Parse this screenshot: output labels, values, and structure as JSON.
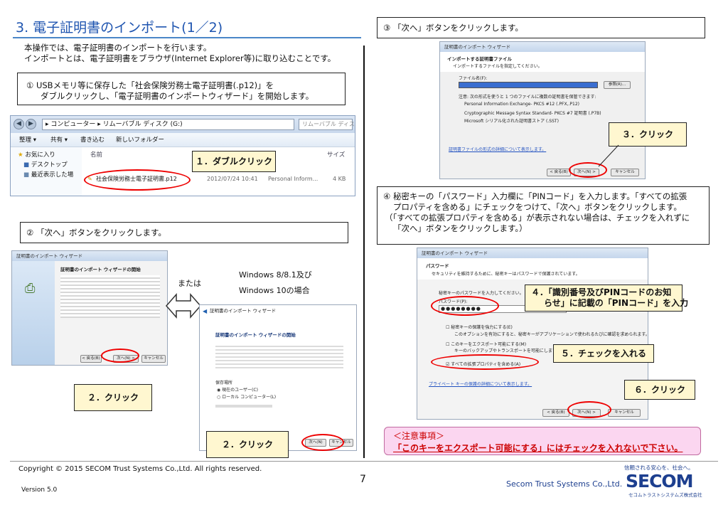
{
  "header": {
    "title": "3. 電子証明書のインポート(1／2)",
    "intro_line1": "本操作では、電子証明書のインポートを行います。",
    "intro_line2": "インポートとは、電子証明書をブラウザ(Internet Explorer等)に取り込むことです。"
  },
  "step1": {
    "line1": "① USBメモリ等に保存した「社会保険労務士電子証明書(.p12)」を",
    "line2": "ダブルクリックし、「電子証明書のインポートウィザード」を開始します。"
  },
  "explorer": {
    "path": "▸ コンピューター ▸ リムーバブル ディスク (G:)",
    "search": "リムーバブル ディス",
    "toolbar": [
      "整理 ▾",
      "共有 ▾",
      "書き込む",
      "新しいフォルダー"
    ],
    "nav": [
      "お気に入り",
      "デスクトップ",
      "最近表示した場"
    ],
    "col_name": "名前",
    "col_size": "サイズ",
    "file": {
      "name": "社会保険労務士電子証明書.p12",
      "date": "2012/07/24 10:41",
      "type": "Personal Inform...",
      "size": "4 KB"
    }
  },
  "callouts": {
    "c1": "１．ダブルクリック",
    "c2a": "２．クリック",
    "c2b": "２．クリック",
    "c3": "３．クリック",
    "c4a": "４．「識別番号及びPINコードのお知",
    "c4b": "らせ」に記載の「PINコード」を入力",
    "c5": "５．チェックを入れる",
    "c6": "６．クリック"
  },
  "step2": {
    "text": "② 「次へ」ボタンをクリックします。",
    "or": "または",
    "win8a": "Windows 8/8.1及び",
    "win8b": "Windows 10の場合"
  },
  "step3": {
    "text": "③ 「次へ」ボタンをクリックします。"
  },
  "step4": {
    "line1": "④ 秘密キーの「パスワード」入力欄に「PINコード」を入力します。「すべての拡張",
    "line2": "プロパティを含める」にチェックをつけて、「次へ」ボタンをクリックします。",
    "line3": "（「すべての拡張プロパティを含める」が表示されない場合は、チェックを入れずに",
    "line4": "「次へ」ボタンをクリックします。）"
  },
  "dialog_a": {
    "title": "証明書のインポート ウィザード",
    "heading": "証明書のインポート ウィザードの開始",
    "next": "次へ(N) >",
    "cancel": "キャンセル",
    "back": "< 戻る(B)"
  },
  "dialog_b": {
    "title": "証明書のインポート ウィザード",
    "heading": "証明書のインポート ウィザードの開始",
    "store": "保存場所",
    "opt1": "現在のユーザー(C)",
    "opt2": "ローカル コンピューター(L)",
    "next": "次へ(N)",
    "cancel": "キャンセル"
  },
  "dialog_c": {
    "title": "証明書のインポート ウィザード",
    "heading": "インポートする証明書ファイル",
    "sub": "インポートするファイルを指定してください。",
    "file_label": "ファイル名(F):",
    "browse": "参照(R)...",
    "note": "注意: 次の形式を使うと 1 つのファイルに複数の証明書を保管できます:",
    "fmt1": "Personal Information Exchange- PKCS #12 (.PFX,.P12)",
    "fmt2": "Cryptographic Message Syntax Standard- PKCS #7 証明書 (.P7B)",
    "fmt3": "Microsoft シリアル化された証明書ストア (.SST)",
    "link": "証明書ファイルの形式の詳細について表示します。",
    "back": "< 戻る(B)",
    "next": "次へ(N) >",
    "cancel": "キャンセル"
  },
  "dialog_d": {
    "title": "証明書のインポート ウィザード",
    "heading": "パスワード",
    "sub": "セキュリティを維持するために、秘密キーはパスワードで保護されています。",
    "pw_prompt": "秘密キーのパスワードを入力してください。",
    "pw_label": "パスワード(P):",
    "pw_value": "●●●●●●●●",
    "chk1": "秘密キーの保護を強力にする(E)",
    "chk1b": "このオプションを有効にすると、秘密キーがアプリケーションで使われるたびに確認を求められます。",
    "chk2": "このキーをエクスポート可能にする(M)",
    "chk2b": "キーのバックアップやトランスポートを可能にします。",
    "chk3": "すべての拡張プロパティを含める(A)",
    "link": "プライベート キーの保護の詳細について表示します。",
    "back": "< 戻る(B)",
    "next": "次へ(N) >",
    "cancel": "キャンセル"
  },
  "notice": {
    "title": "＜注意事項＞",
    "body": "「このキーをエクスポート可能にする」にはチェックを入れないで下さい。"
  },
  "footer": {
    "copyright": "Copyright © 2015 SECOM Trust Systems Co.,Ltd. All rights reserved.",
    "version": "Version 5.0",
    "page": "7",
    "company": "Secom Trust Systems Co.,Ltd.",
    "tagline": "信頼される安心を、社会へ。",
    "logo": "SECOM",
    "logo_sub": "セコムトラストシステムズ株式会社"
  },
  "colors": {
    "title": "#1f55b0",
    "callout_bg": "#fff7d0",
    "oval": "#e00000",
    "notice_bg": "#fbd6f0",
    "logo": "#1d3f8f"
  }
}
